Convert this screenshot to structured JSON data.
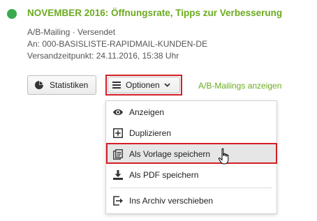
{
  "mailing": {
    "title": "NOVEMBER 2016: Öffnungsrate, Tipps zur Verbesserung",
    "type_line": "A/B-Mailing · Versendet",
    "recipient_line": "An: 000-BASISLISTE-RAPIDMAIL-KUNDEN-DE",
    "sent_line": "Versandzeitpunkt: 24.11.2016, 15:38 Uhr",
    "status_color": "#3aaa4e"
  },
  "actions": {
    "stats_label": "Statistiken",
    "stats_icon": "pie-chart-icon",
    "options_label": "Optionen",
    "options_icon": "menu-icon",
    "ab_link_label": "A/B-Mailings anzeigen"
  },
  "menu": {
    "items": [
      {
        "label": "Anzeigen",
        "icon": "eye-icon"
      },
      {
        "label": "Duplizieren",
        "icon": "duplicate-icon"
      },
      {
        "label": "Als Vorlage speichern",
        "icon": "template-icon",
        "hovered": true
      },
      {
        "label": "Als PDF speichern",
        "icon": "download-icon"
      },
      {
        "label": "Ins Archiv verschieben",
        "icon": "archive-icon"
      }
    ]
  },
  "colors": {
    "accent_green": "#6bab1f",
    "highlight_red": "#d21f26"
  }
}
